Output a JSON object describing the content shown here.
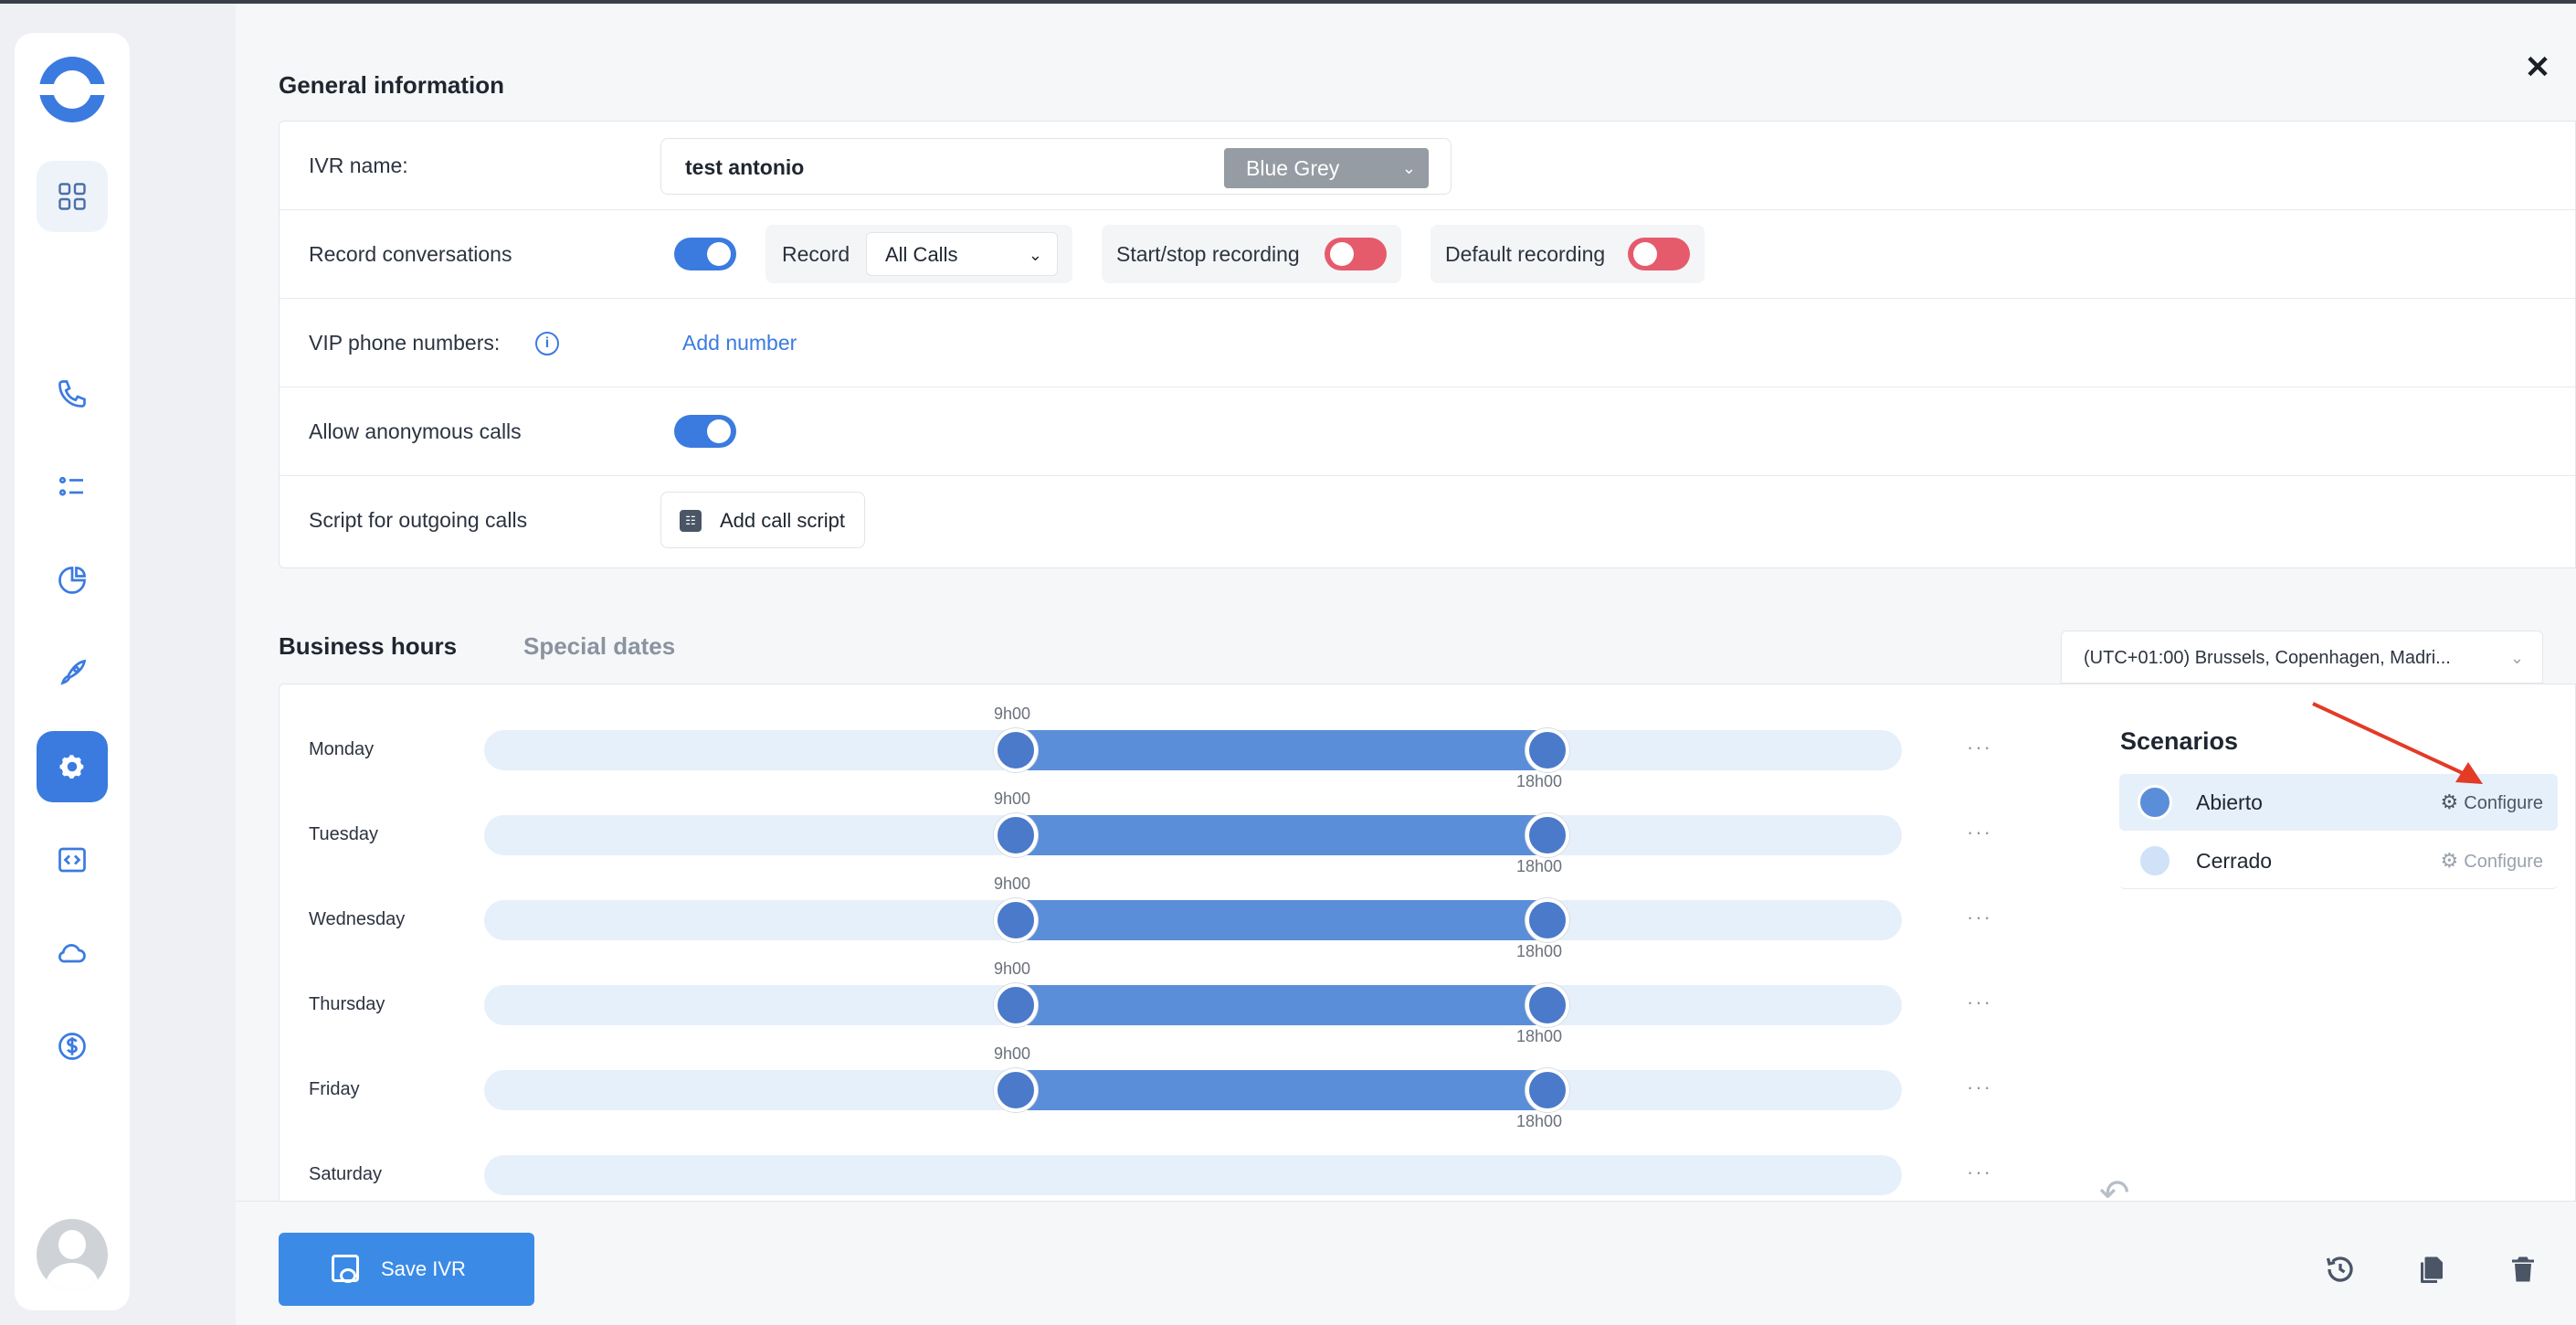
{
  "general": {
    "title": "General information",
    "rows": {
      "ivr_name_label": "IVR name:",
      "ivr_name_value": "test antonio",
      "color_value": "Blue Grey",
      "record_label": "Record conversations",
      "record_mode_label": "Record",
      "record_mode_value": "All Calls",
      "start_stop_label": "Start/stop recording",
      "default_recording_label": "Default recording",
      "vip_label": "VIP phone numbers:",
      "vip_link": "Add number",
      "anon_label": "Allow anonymous calls",
      "script_label": "Script for outgoing calls",
      "script_button": "Add call script"
    },
    "toggles": {
      "record_conversations": true,
      "start_stop_recording": false,
      "default_recording": false,
      "allow_anonymous": true
    }
  },
  "tabs": {
    "business_hours": "Business hours",
    "special_dates": "Special dates"
  },
  "timezone": "(UTC+01:00) Brussels, Copenhagen, Madri...",
  "schedule": [
    {
      "day": "Monday",
      "start": "9h00",
      "end": "18h00"
    },
    {
      "day": "Tuesday",
      "start": "9h00",
      "end": "18h00"
    },
    {
      "day": "Wednesday",
      "start": "9h00",
      "end": "18h00"
    },
    {
      "day": "Thursday",
      "start": "9h00",
      "end": "18h00"
    },
    {
      "day": "Friday",
      "start": "9h00",
      "end": "18h00"
    },
    {
      "day": "Saturday",
      "start": "",
      "end": ""
    }
  ],
  "more_icon": "···",
  "scenarios": {
    "title": "Scenarios",
    "items": [
      {
        "name": "Abierto",
        "action": "Configure",
        "color": "#5b8ed8"
      },
      {
        "name": "Cerrado",
        "action": "Configure",
        "color": "#cfe2f7"
      }
    ]
  },
  "footer": {
    "save_label": "Save IVR"
  },
  "colors": {
    "accent": "#3b7be0",
    "toggle_off": "#e55b6c",
    "range": "#5b8ed8",
    "annotation_arrow": "#e23b26"
  }
}
